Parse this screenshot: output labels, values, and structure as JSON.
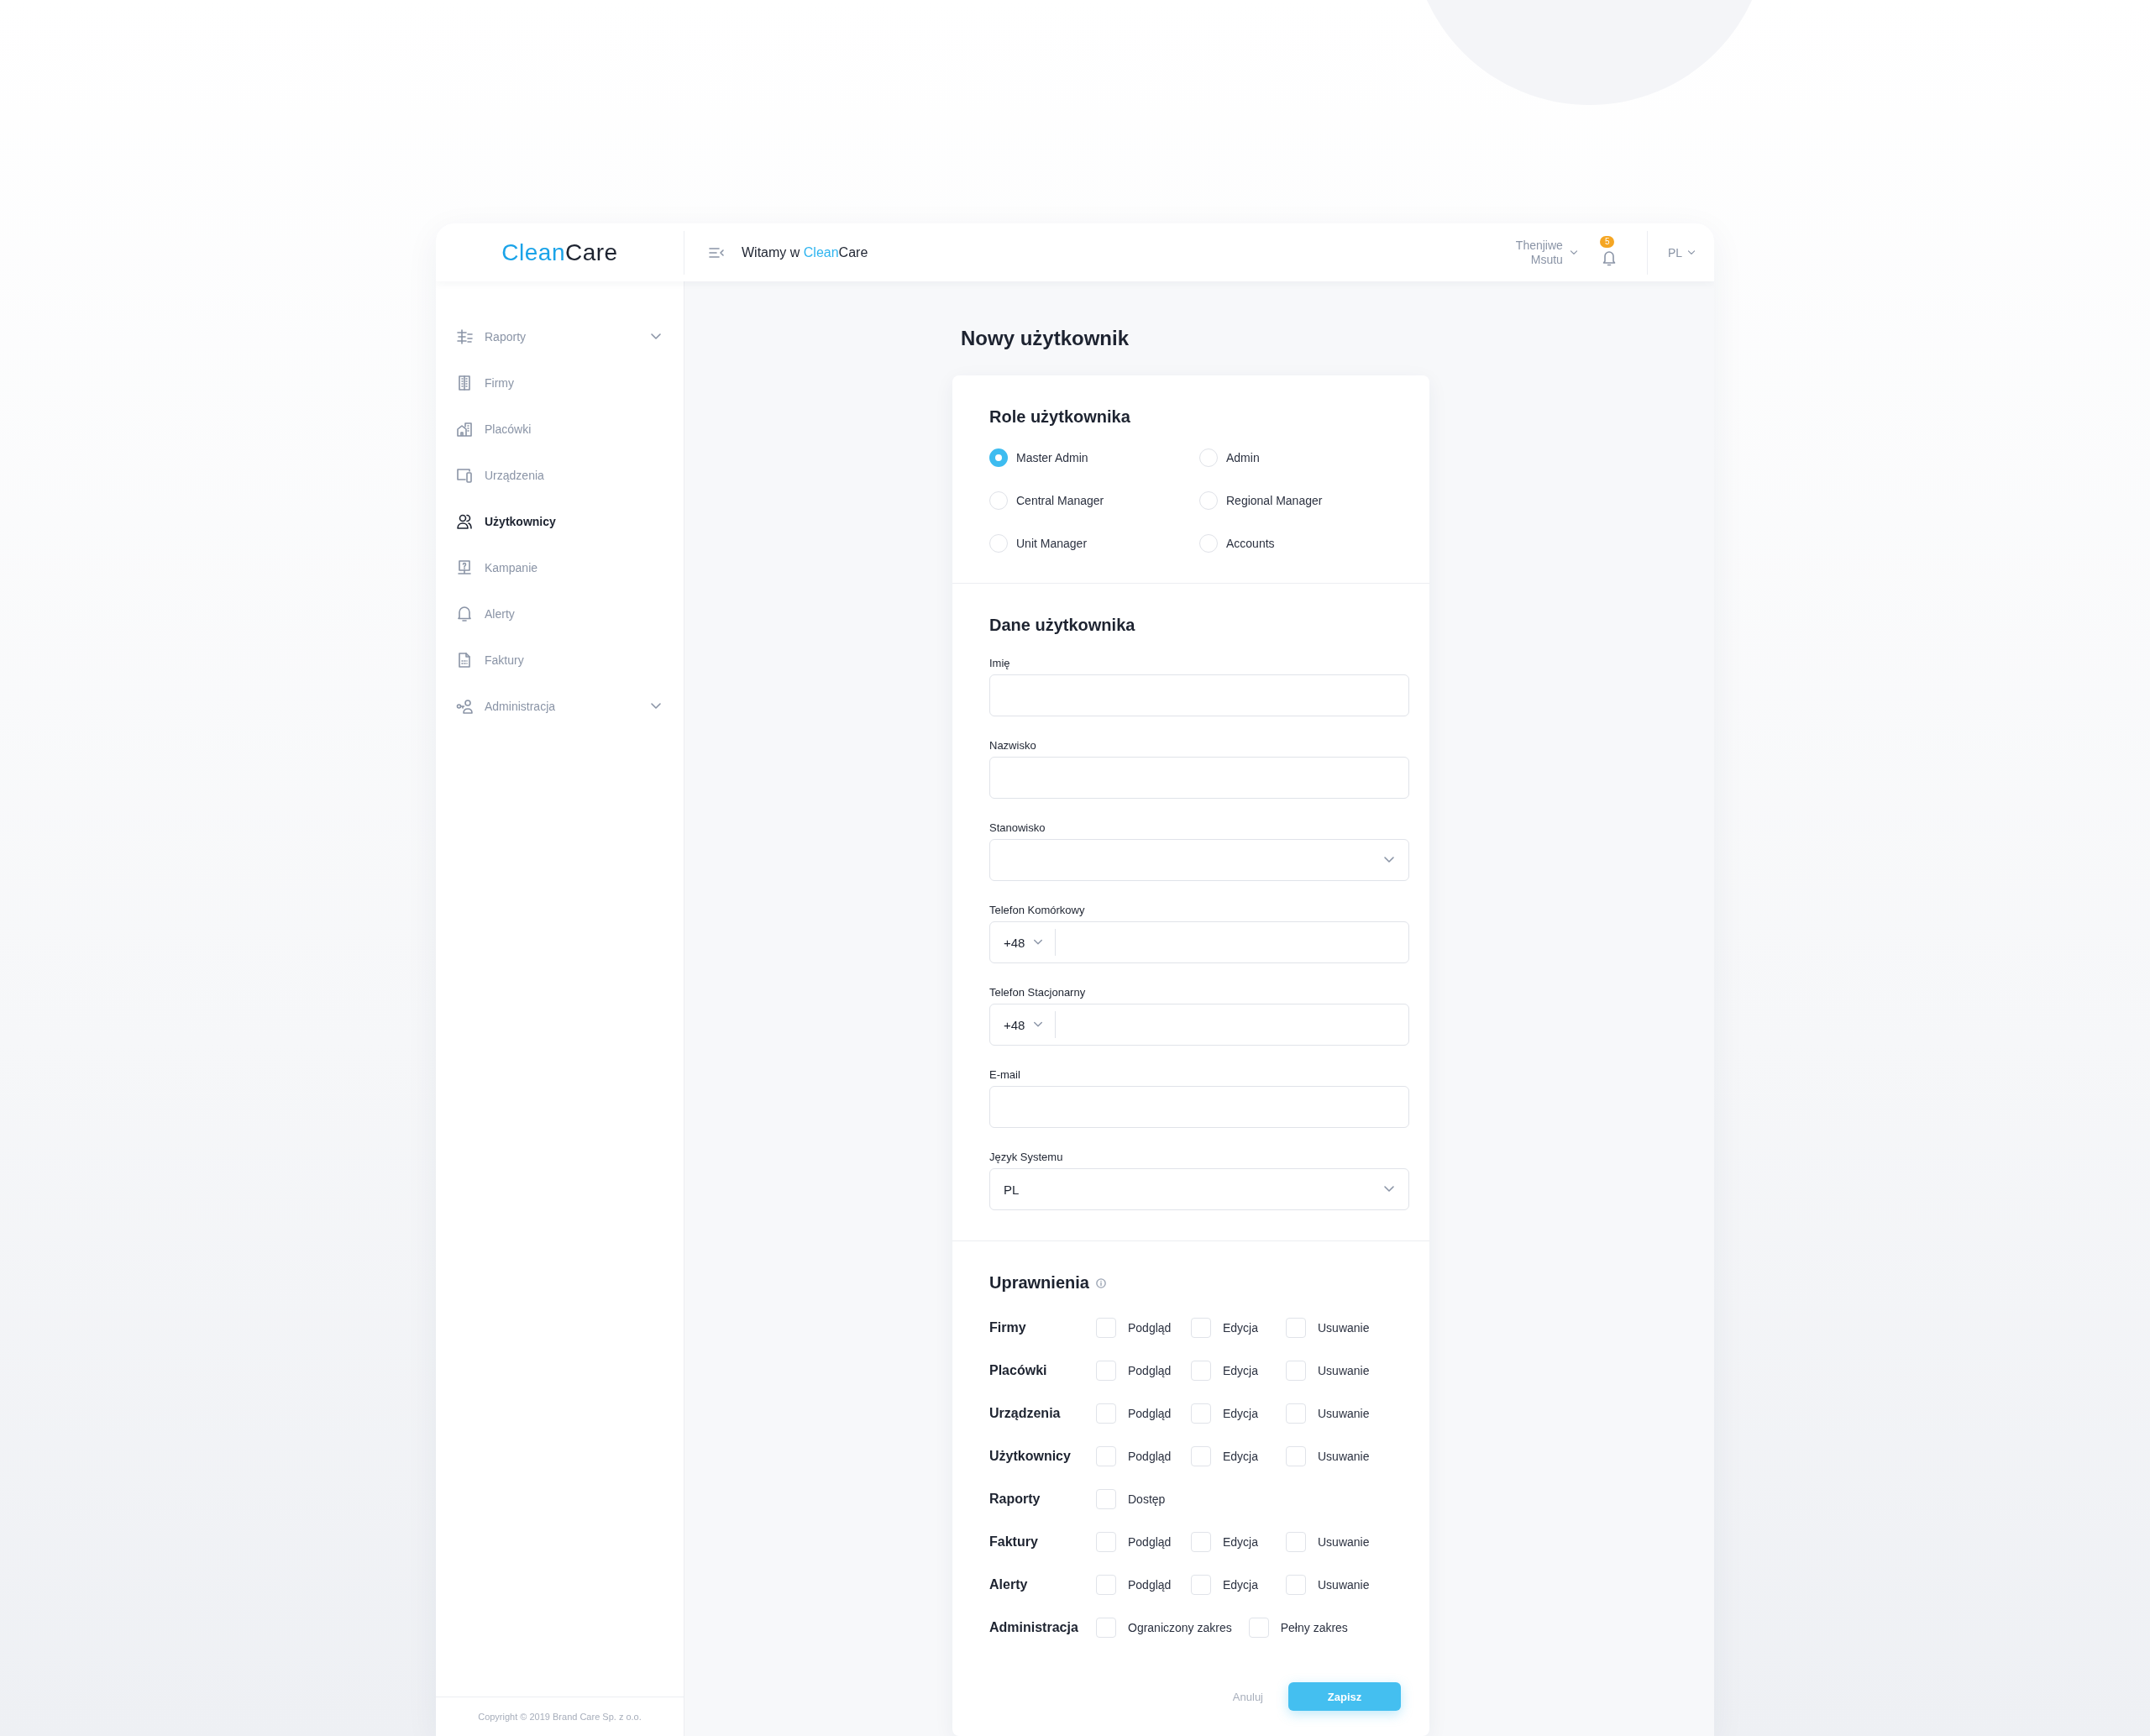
{
  "logo": {
    "accent": "Clean",
    "rest": "Care"
  },
  "header": {
    "greeting": [
      {
        "text": "Witamy w ",
        "accent": false
      },
      {
        "text": "Clean",
        "accent": true
      },
      {
        "text": "Care",
        "accent": false
      }
    ],
    "user_name": [
      "Thenjiwe",
      "Msutu"
    ],
    "notification_count": "5",
    "language": "PL"
  },
  "sidebar": {
    "items": [
      {
        "label": "Raporty",
        "selected": false,
        "expandable": true
      },
      {
        "label": "Firmy",
        "selected": false,
        "expandable": false
      },
      {
        "label": "Placówki",
        "selected": false,
        "expandable": false
      },
      {
        "label": "Urządzenia",
        "selected": false,
        "expandable": false
      },
      {
        "label": "Użytkownicy",
        "selected": true,
        "expandable": false
      },
      {
        "label": "Kampanie",
        "selected": false,
        "expandable": false
      },
      {
        "label": "Alerty",
        "selected": false,
        "expandable": false
      },
      {
        "label": "Faktury",
        "selected": false,
        "expandable": false
      },
      {
        "label": "Administracja",
        "selected": false,
        "expandable": true
      }
    ],
    "copyright": "Copyright © 2019 Brand Care Sp. z o.o."
  },
  "page_title": "Nowy użytkownik",
  "roles": {
    "heading": "Role użytkownika",
    "options": [
      {
        "label": "Master Admin",
        "selected": true
      },
      {
        "label": "Admin",
        "selected": false
      },
      {
        "label": "Central Manager",
        "selected": false
      },
      {
        "label": "Regional Manager",
        "selected": false
      },
      {
        "label": "Unit Manager",
        "selected": false
      },
      {
        "label": "Accounts",
        "selected": false
      }
    ]
  },
  "user_data": {
    "heading": "Dane użytkownika",
    "fields": [
      {
        "label": "Imię",
        "kind": "text"
      },
      {
        "label": "Nazwisko",
        "kind": "text"
      },
      {
        "label": "Stanowisko",
        "kind": "select"
      },
      {
        "label": "Telefon Komórkowy",
        "kind": "phone",
        "prefix": "+48"
      },
      {
        "label": "Telefon Stacjonarny",
        "kind": "phone",
        "prefix": "+48"
      },
      {
        "label": "E-mail",
        "kind": "text"
      },
      {
        "label": "Język Systemu",
        "kind": "select",
        "value": "PL"
      }
    ]
  },
  "permissions": {
    "heading": "Uprawnienia",
    "rows": [
      {
        "label": "Firmy",
        "options": [
          {
            "label": "Podgląd",
            "checked": false
          },
          {
            "label": "Edycja",
            "checked": false
          },
          {
            "label": "Usuwanie",
            "checked": false
          }
        ]
      },
      {
        "label": "Placówki",
        "options": [
          {
            "label": "Podgląd",
            "checked": false
          },
          {
            "label": "Edycja",
            "checked": false
          },
          {
            "label": "Usuwanie",
            "checked": false
          }
        ]
      },
      {
        "label": "Urządzenia",
        "options": [
          {
            "label": "Podgląd",
            "checked": false
          },
          {
            "label": "Edycja",
            "checked": false
          },
          {
            "label": "Usuwanie",
            "checked": false
          }
        ]
      },
      {
        "label": "Użytkownicy",
        "options": [
          {
            "label": "Podgląd",
            "checked": false
          },
          {
            "label": "Edycja",
            "checked": false
          },
          {
            "label": "Usuwanie",
            "checked": false
          }
        ]
      },
      {
        "label": "Raporty",
        "options": [
          {
            "label": "Dostęp",
            "checked": false
          }
        ]
      },
      {
        "label": "Faktury",
        "options": [
          {
            "label": "Podgląd",
            "checked": false
          },
          {
            "label": "Edycja",
            "checked": false
          },
          {
            "label": "Usuwanie",
            "checked": false
          }
        ]
      },
      {
        "label": "Alerty",
        "options": [
          {
            "label": "Podgląd",
            "checked": false
          },
          {
            "label": "Edycja",
            "checked": false
          },
          {
            "label": "Usuwanie",
            "checked": false
          }
        ]
      },
      {
        "label": "Administracja",
        "options": [
          {
            "label": "Ograniczony zakres",
            "checked": false
          },
          {
            "label": "Pełny zakres",
            "checked": false
          }
        ]
      }
    ]
  },
  "actions": {
    "cancel": "Anuluj",
    "save": "Zapisz"
  }
}
